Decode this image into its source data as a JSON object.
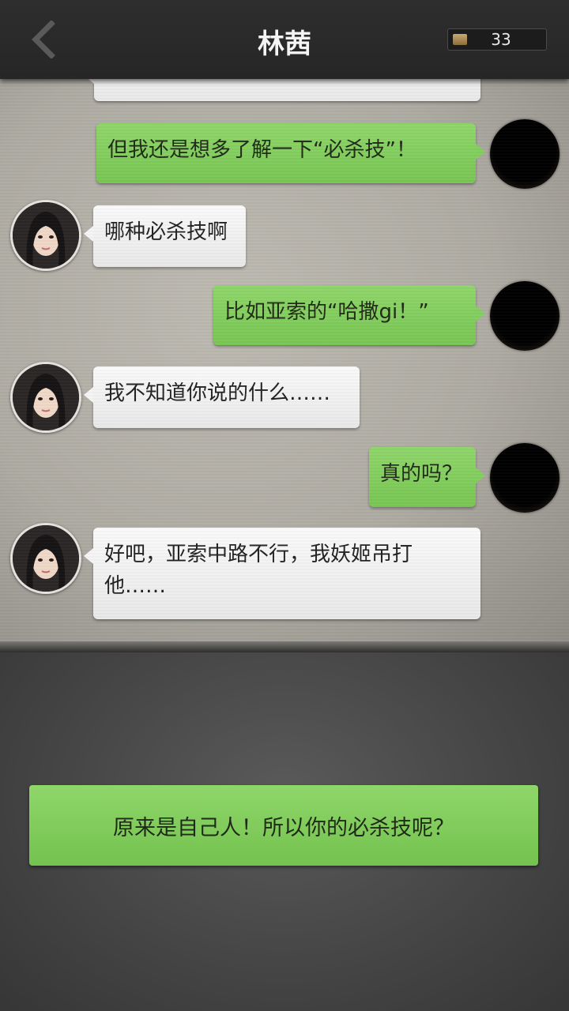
{
  "header": {
    "title": "林茜",
    "coins": "33"
  },
  "messages": [
    {
      "side": "left",
      "text": "…"
    },
    {
      "side": "right",
      "text": "但我还是想多了解一下“必杀技”！"
    },
    {
      "side": "left",
      "text": "哪种必杀技啊"
    },
    {
      "side": "right",
      "text": "比如亚索的“哈撒gi！”"
    },
    {
      "side": "left",
      "text": "我不知道你说的什么……"
    },
    {
      "side": "right",
      "text": "真的吗？"
    },
    {
      "side": "left",
      "text": "好吧，亚索中路不行，我妖姬吊打他……"
    }
  ],
  "reply_option": "原来是自己人！所以你的必杀技呢？",
  "colors": {
    "bubble_right": "#83cf5e",
    "bubble_left": "#f5f5f5",
    "topbar": "#2a2a2a"
  }
}
